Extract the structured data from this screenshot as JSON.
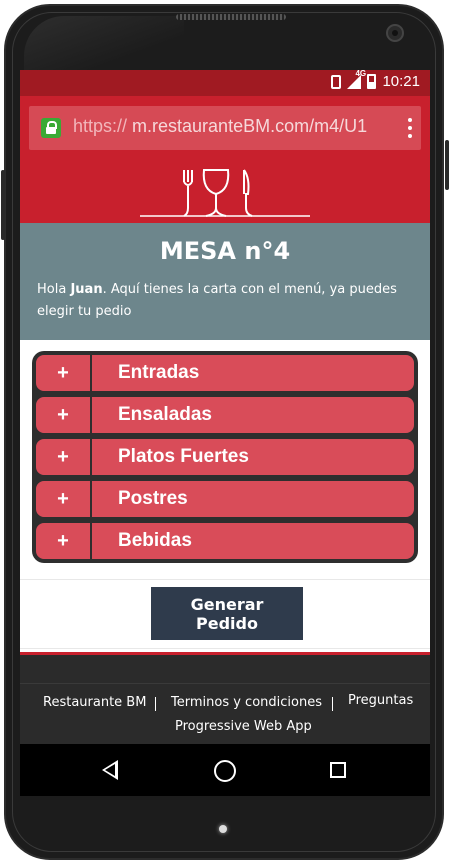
{
  "status": {
    "network": "4G",
    "time": "10:21"
  },
  "browser": {
    "url_protocol": "https://",
    "url_rest": " m.restauranteBM.com/m4/U1"
  },
  "page": {
    "title": "MESA n°4",
    "greeting_prefix": "Hola ",
    "greeting_name": "Juan",
    "greeting_rest": ". Aquí tienes la carta con el menú, ya puedes elegir tu pedio"
  },
  "menu": [
    {
      "symbol": "+",
      "label": "Entradas"
    },
    {
      "symbol": "+",
      "label": "Ensaladas"
    },
    {
      "symbol": "+",
      "label": "Platos Fuertes"
    },
    {
      "symbol": "+",
      "label": "Postres"
    },
    {
      "symbol": "+",
      "label": "Bebidas"
    }
  ],
  "actions": {
    "generate_order": "Generar Pedido"
  },
  "footer": {
    "link1": "Restaurante BM",
    "link2": "Terminos y condiciones",
    "link3": "Preguntas",
    "link4": "Progressive Web App"
  },
  "colors": {
    "brand_red": "#c8202d",
    "hero_gray": "#6d868c",
    "menu_item": "#d94c59",
    "button_dark": "#2f3b4c"
  },
  "icons": [
    "lock-icon",
    "vibrate-icon",
    "signal-icon",
    "battery-icon",
    "kebab-menu-icon",
    "restaurant-logo-icon",
    "back-icon",
    "home-icon",
    "recents-icon"
  ]
}
